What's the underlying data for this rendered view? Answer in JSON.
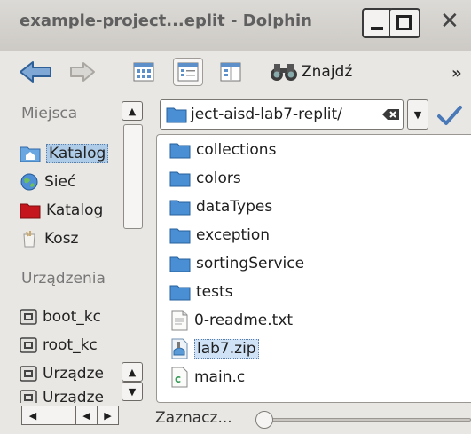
{
  "window": {
    "title": "example-project...eplit - Dolphin"
  },
  "toolbar": {
    "back_icon": "arrow-left-icon",
    "forward_icon": "arrow-right-icon",
    "icons_view_icon": "icons-view-icon",
    "details_view_icon": "details-view-icon",
    "columns_view_icon": "columns-view-icon",
    "search_label": "Znajdź",
    "more_label": "»"
  },
  "sidebar": {
    "places_header": "Miejsca",
    "places": [
      {
        "label": "Katalog",
        "icon": "home-folder-icon",
        "selected": true
      },
      {
        "label": "Sieć",
        "icon": "network-globe-icon",
        "selected": false
      },
      {
        "label": "Katalog",
        "icon": "root-folder-icon",
        "selected": false
      },
      {
        "label": "Kosz",
        "icon": "trash-icon",
        "selected": false
      }
    ],
    "devices_header": "Urządzenia",
    "devices": [
      {
        "label": "boot_kc",
        "icon": "drive-icon"
      },
      {
        "label": "root_kc",
        "icon": "drive-icon"
      },
      {
        "label": "Urządze",
        "icon": "drive-icon"
      },
      {
        "label": "Urządze",
        "icon": "drive-icon"
      }
    ]
  },
  "location": {
    "path": "ject-aisd-lab7-replit/"
  },
  "files": [
    {
      "name": "collections",
      "icon": "folder-icon",
      "selected": false
    },
    {
      "name": "colors",
      "icon": "folder-icon",
      "selected": false
    },
    {
      "name": "dataTypes",
      "icon": "folder-icon",
      "selected": false
    },
    {
      "name": "exception",
      "icon": "folder-icon",
      "selected": false
    },
    {
      "name": "sortingService",
      "icon": "folder-icon",
      "selected": false
    },
    {
      "name": "tests",
      "icon": "folder-icon",
      "selected": false
    },
    {
      "name": "0-readme.txt",
      "icon": "text-file-icon",
      "selected": false
    },
    {
      "name": "lab7.zip",
      "icon": "archive-file-icon",
      "selected": true
    },
    {
      "name": "main.c",
      "icon": "c-source-file-icon",
      "selected": false
    }
  ],
  "status": {
    "text": "Zaznacz..."
  },
  "colors": {
    "selection": "#cfe2f6",
    "folder_blue": "#4a8fd3",
    "background": "#e9e7e3"
  }
}
